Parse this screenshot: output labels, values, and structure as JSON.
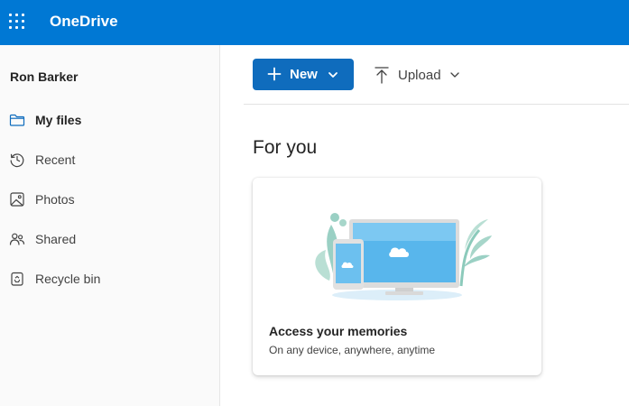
{
  "app": {
    "title": "OneDrive",
    "launcher_icon": "app-launcher-icon",
    "accent_color": "#0078d4"
  },
  "sidebar": {
    "user_name": "Ron Barker",
    "items": [
      {
        "label": "My files",
        "icon": "folder-icon",
        "active": true
      },
      {
        "label": "Recent",
        "icon": "history-icon",
        "active": false
      },
      {
        "label": "Photos",
        "icon": "image-icon",
        "active": false
      },
      {
        "label": "Shared",
        "icon": "people-icon",
        "active": false
      },
      {
        "label": "Recycle bin",
        "icon": "recycle-bin-icon",
        "active": false
      }
    ]
  },
  "toolbar": {
    "new_label": "New",
    "new_button_color": "#0f6cbd",
    "upload_label": "Upload"
  },
  "main": {
    "section_title": "For you",
    "card": {
      "title": "Access your memories",
      "subtitle": "On any device, anywhere, anytime"
    }
  }
}
